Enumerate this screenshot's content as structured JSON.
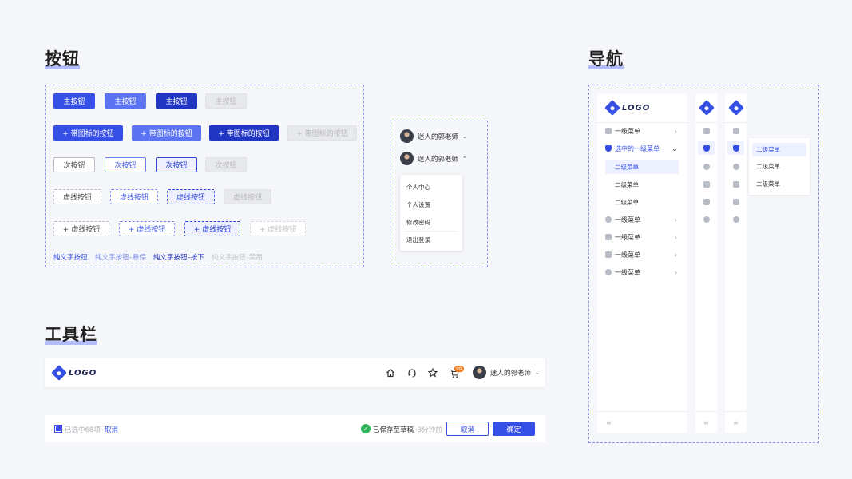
{
  "sections": {
    "buttons": "按钮",
    "nav": "导航",
    "toolbar": "工具栏"
  },
  "buttons": {
    "primary": [
      "主按钮",
      "主按钮",
      "主按钮",
      "主按钮"
    ],
    "icon_primary": [
      "+ 带图标的按钮",
      "+ 带图标的按钮",
      "+ 带图标的按钮",
      "+ 带图标的按钮"
    ],
    "secondary": [
      "次按钮",
      "次按钮",
      "次按钮",
      "次按钮"
    ],
    "dashed": [
      "虚线按钮",
      "虚线按钮",
      "虚线按钮",
      "虚线按钮"
    ],
    "dashed_icon": [
      "+ 虚线按钮",
      "+ 虚线按钮",
      "+ 虚线按钮",
      "+ 虚线按钮"
    ],
    "text": [
      "纯文字按钮",
      "纯文字按钮–悬停",
      "纯文字按钮–按下",
      "纯文字按钮–禁用"
    ]
  },
  "user": {
    "name": "迷人的郭老师",
    "menu": [
      "个人中心",
      "个人设置",
      "修改密码",
      "退出登录"
    ]
  },
  "logo": "LOGO",
  "nav": {
    "items": [
      "一级菜单",
      "选中的一级菜单",
      "一级菜单",
      "一级菜单",
      "一级菜单",
      "一级菜单"
    ],
    "subitems": [
      "二级菜单",
      "二级菜单",
      "二级菜单"
    ]
  },
  "toolbar": {
    "cart_badge": "99",
    "selected": "已选中68项",
    "cancel": "取消",
    "saved": "已保存至草稿",
    "saved_time": "·3分钟前",
    "cancel_btn": "取消",
    "confirm_btn": "确定"
  },
  "colors": {
    "primary": "#3650e6",
    "accent_soft": "#9aa8f7",
    "badge": "#f27a1a",
    "success": "#2fb55a"
  }
}
